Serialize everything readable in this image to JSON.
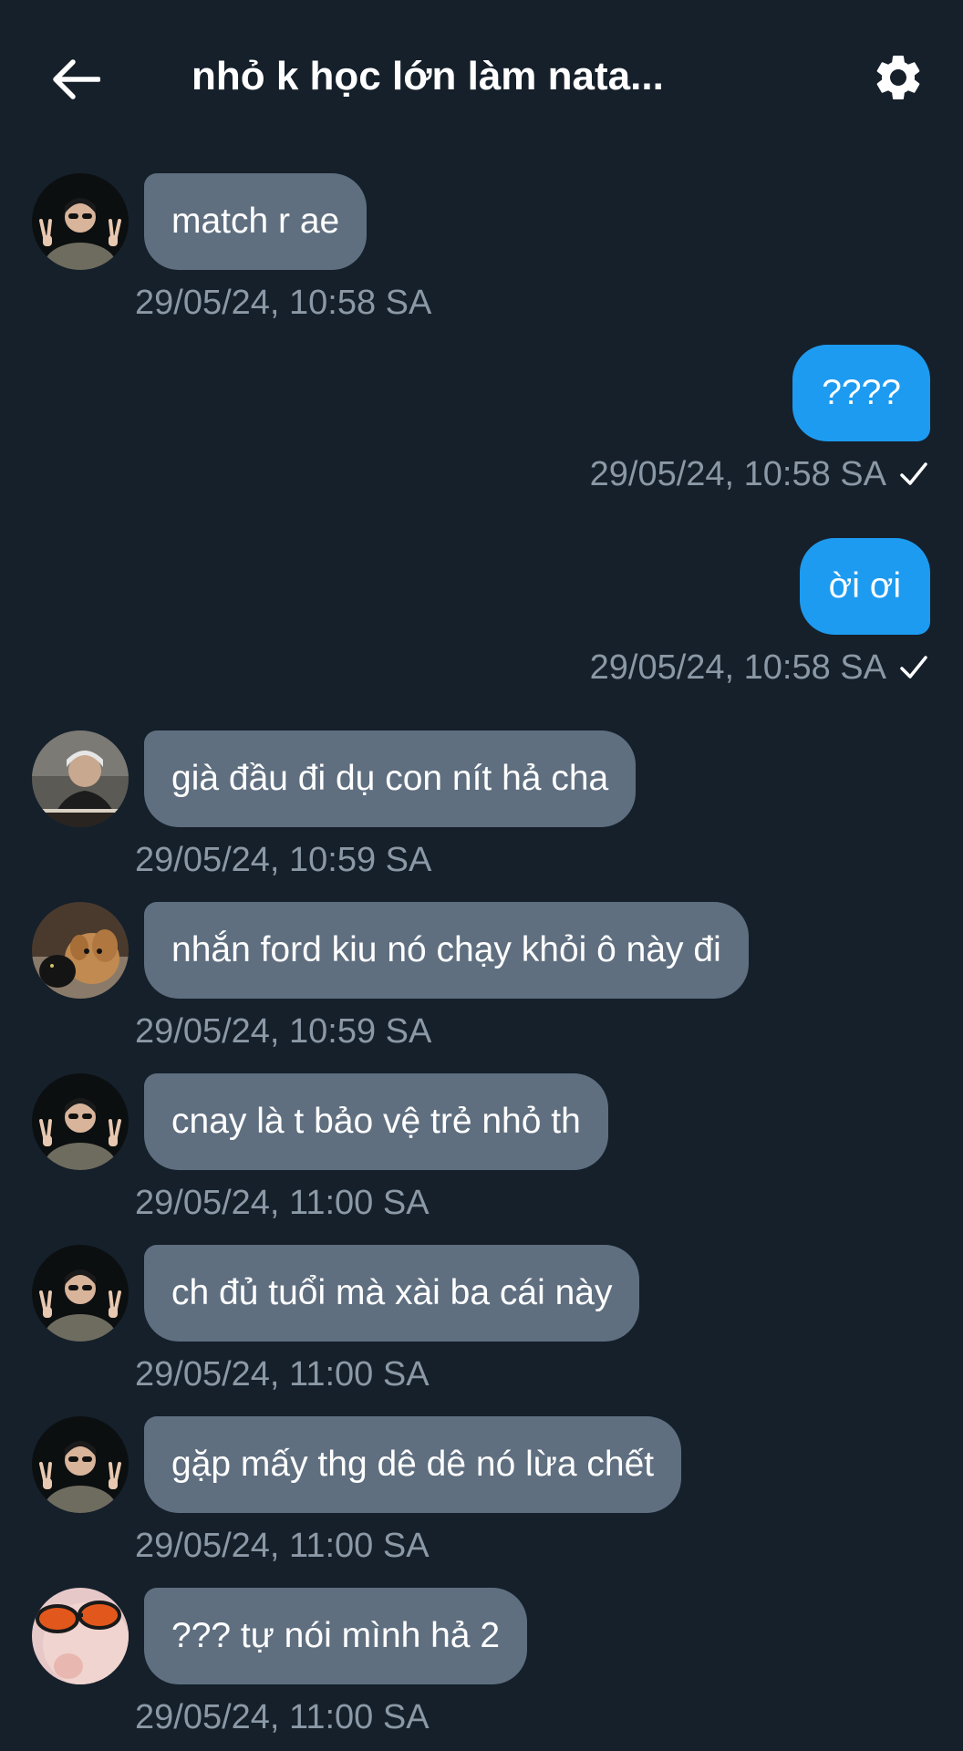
{
  "header": {
    "title": "nhỏ k học lớn làm nata...",
    "back_icon": "arrow-left-icon",
    "settings_icon": "gear-icon"
  },
  "colors": {
    "background": "#15202b",
    "incoming_bubble": "#5f6f80",
    "outgoing_bubble": "#1d9bf0",
    "timestamp": "#8b98a5"
  },
  "messages": [
    {
      "text": "match r ae",
      "time": "29/05/24, 10:58 SA",
      "direction": "in",
      "avatar": "avatar-man-sunglasses-peace"
    },
    {
      "text": "????",
      "time": "29/05/24, 10:58 SA",
      "direction": "out",
      "status_icon": "check-icon"
    },
    {
      "text": "ời ơi",
      "time": "29/05/24, 10:58 SA",
      "direction": "out",
      "status_icon": "check-icon"
    },
    {
      "text": "già đầu đi dụ con nít hả cha",
      "time": "29/05/24, 10:59 SA",
      "direction": "in",
      "avatar": "avatar-man-desk"
    },
    {
      "text": "nhắn ford kiu nó chạy khỏi ô này đi",
      "time": "29/05/24, 10:59 SA",
      "direction": "in",
      "avatar": "avatar-dog-cat"
    },
    {
      "text": "cnay là t bảo vệ trẻ nhỏ th",
      "time": "29/05/24, 11:00 SA",
      "direction": "in",
      "avatar": "avatar-man-sunglasses-peace"
    },
    {
      "text": "ch đủ tuổi mà xài ba cái này",
      "time": "29/05/24, 11:00 SA",
      "direction": "in",
      "avatar": "avatar-man-sunglasses-peace"
    },
    {
      "text": "gặp mấy thg dê dê nó lừa chết",
      "time": "29/05/24, 11:00 SA",
      "direction": "in",
      "avatar": "avatar-man-sunglasses-peace"
    },
    {
      "text": "??? tự nói mình hả 2",
      "time": "29/05/24, 11:00 SA",
      "direction": "in",
      "avatar": "avatar-orange-glasses"
    }
  ]
}
